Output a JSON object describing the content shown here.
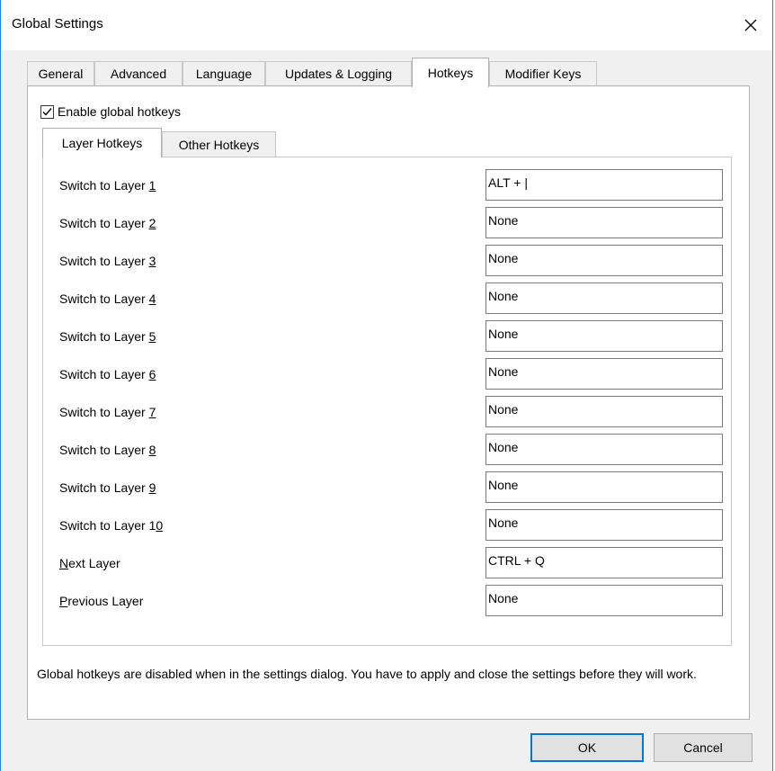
{
  "window": {
    "title": "Global Settings"
  },
  "tabs": [
    {
      "label": "General",
      "active": false
    },
    {
      "label": "Advanced",
      "active": false
    },
    {
      "label": "Language",
      "active": false
    },
    {
      "label": "Updates & Logging",
      "active": false
    },
    {
      "label": "Hotkeys",
      "active": true
    },
    {
      "label": "Modifier Keys",
      "active": false
    }
  ],
  "hotkeys": {
    "enable": {
      "label": "Enable global hotkeys",
      "checked": true
    },
    "subtabs": [
      {
        "label": "Layer Hotkeys",
        "active": true
      },
      {
        "label": "Other Hotkeys",
        "active": false
      }
    ],
    "rows": [
      {
        "label_pre": "Switch to Layer ",
        "label_u": "1",
        "label_post": "",
        "value": "ALT + |"
      },
      {
        "label_pre": "Switch to Layer ",
        "label_u": "2",
        "label_post": "",
        "value": "None"
      },
      {
        "label_pre": "Switch to Layer ",
        "label_u": "3",
        "label_post": "",
        "value": "None"
      },
      {
        "label_pre": "Switch to Layer ",
        "label_u": "4",
        "label_post": "",
        "value": "None"
      },
      {
        "label_pre": "Switch to Layer ",
        "label_u": "5",
        "label_post": "",
        "value": "None"
      },
      {
        "label_pre": "Switch to Layer ",
        "label_u": "6",
        "label_post": "",
        "value": "None"
      },
      {
        "label_pre": "Switch to Layer ",
        "label_u": "7",
        "label_post": "",
        "value": "None"
      },
      {
        "label_pre": "Switch to Layer ",
        "label_u": "8",
        "label_post": "",
        "value": "None"
      },
      {
        "label_pre": "Switch to Layer ",
        "label_u": "9",
        "label_post": "",
        "value": "None"
      },
      {
        "label_pre": "Switch to Layer 1",
        "label_u": "0",
        "label_post": "",
        "value": "None"
      },
      {
        "label_pre": "",
        "label_u": "N",
        "label_post": "ext Layer",
        "value": "CTRL + Q"
      },
      {
        "label_pre": "",
        "label_u": "P",
        "label_post": "revious Layer",
        "value": "None"
      }
    ]
  },
  "note": "Global hotkeys are disabled when in the settings dialog. You have to apply and close the settings before they will work.",
  "buttons": {
    "ok": "OK",
    "cancel": "Cancel"
  },
  "colors": {
    "accent": "#0078d7",
    "window_border": "#1f8ad2",
    "dialog_bg": "#f0f0f0"
  }
}
